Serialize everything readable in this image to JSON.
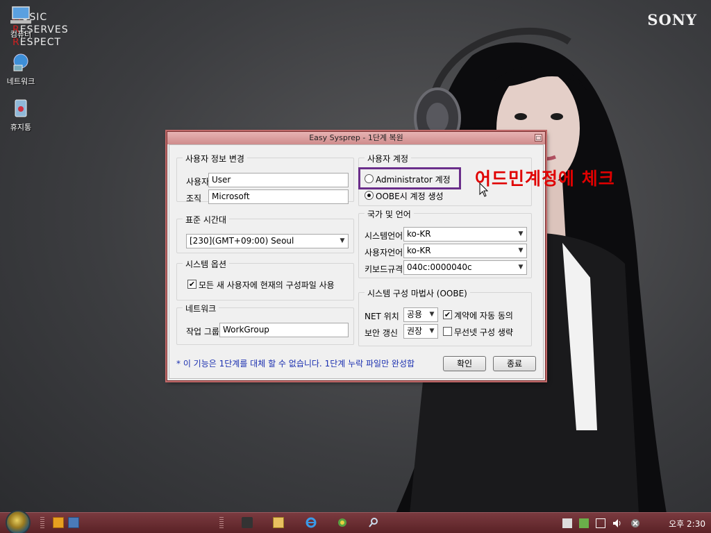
{
  "wallpaper": {
    "brand": "SONY",
    "watermark_lines": [
      {
        "first": "M",
        "rest": "USIC"
      },
      {
        "first": "R",
        "rest": "ESERVES"
      },
      {
        "first": "R",
        "rest": "ESPECT"
      }
    ]
  },
  "desktop": {
    "icons": [
      {
        "label": "컴퓨터",
        "icon": "computer-icon"
      },
      {
        "label": "네트워크",
        "icon": "network-icon"
      },
      {
        "label": "휴지통",
        "icon": "recycle-bin-icon"
      }
    ]
  },
  "dialog": {
    "title": "Easy Sysprep - 1단계 복원",
    "user_info": {
      "legend": "사용자 정보 변경",
      "user_label": "사용자",
      "user_value": "User",
      "org_label": "조직",
      "org_value": "Microsoft"
    },
    "timezone": {
      "legend": "표준 시간대",
      "value": "[230](GMT+09:00) Seoul"
    },
    "system_options": {
      "legend": "시스템 옵션",
      "copy_profile_label": "모든 새 사용자에 현재의 구성파일 사용",
      "copy_profile_checked": true
    },
    "network": {
      "legend": "네트워크",
      "workgroup_label": "작업 그룹",
      "workgroup_value": "WorkGroup"
    },
    "user_account": {
      "legend": "사용자 계정",
      "admin_label": "Administrator 계정",
      "oobe_label": "OOBE시 계정 생성",
      "selected": "oobe"
    },
    "locale": {
      "legend": "국가 및 언어",
      "system_label": "시스템언어",
      "system_value": "ko-KR",
      "user_label": "사용자언어",
      "user_value": "ko-KR",
      "keyboard_label": "키보드규격",
      "keyboard_value": "040c:0000040c"
    },
    "oobe": {
      "legend": "시스템 구성 마법사 (OOBE)",
      "net_label": "NET 위치",
      "net_value": "공용",
      "eula_label": "계약에 자동 동의",
      "eula_checked": true,
      "security_label": "보안 갱신",
      "security_value": "권장",
      "skip_wireless_label": "무선넷 구성 생략",
      "skip_wireless_checked": false
    },
    "note": "* 이 기능은 1단계를 대체 할 수 없습니다. 1단계 누락 파일만 완성합",
    "ok_label": "확인",
    "close_label": "종료"
  },
  "annotation": {
    "text": "어드민계정에 체크",
    "color": "#e00000"
  },
  "taskbar": {
    "clock": "오후 2:30",
    "pinned_icons": [
      "task-manager-icon",
      "explorer-icon",
      "internet-explorer-icon",
      "network-tool-icon",
      "search-tool-icon"
    ],
    "tray_icons": [
      "flag-icon",
      "network-check-icon",
      "monitor-icon",
      "volume-icon",
      "close-circle-icon"
    ]
  },
  "colors": {
    "taskbar": "#6a2c31",
    "dialog_frame": "#c06a6a",
    "highlight_box": "#6a2e8a",
    "note_text": "#1a2fb0"
  }
}
